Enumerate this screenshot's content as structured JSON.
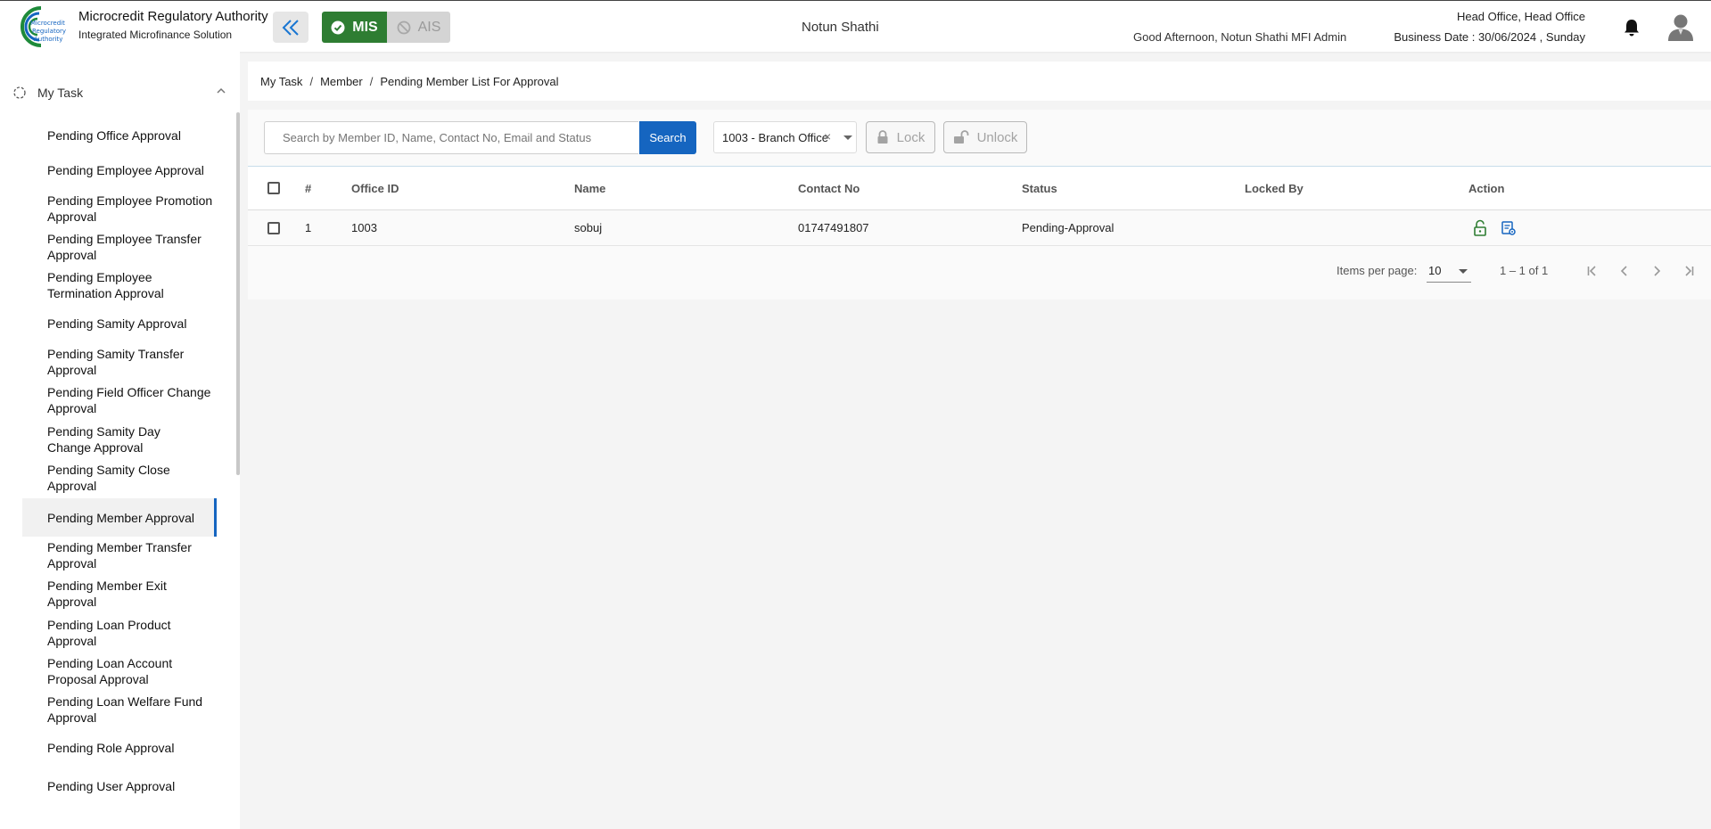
{
  "header": {
    "brand_title": "Microcredit Regulatory Authority",
    "brand_subtitle": "Integrated Microfinance Solution",
    "logo_lines": [
      "Microcredit",
      "Regulatory",
      "Authority"
    ],
    "mis_label": "MIS",
    "ais_label": "AIS",
    "org_name": "Notun Shathi",
    "greeting": "Good Afternoon, Notun Shathi MFI Admin",
    "office": "Head Office, Head Office",
    "business_date": "Business Date : 30/06/2024 , Sunday"
  },
  "sidebar": {
    "section_label": "My Task",
    "items": [
      {
        "label": "Pending Office Approval",
        "active": false
      },
      {
        "label": "Pending Employee Approval",
        "active": false
      },
      {
        "label": "Pending Employee Promotion Approval",
        "active": false
      },
      {
        "label": "Pending Employee Transfer Approval",
        "active": false
      },
      {
        "label": "Pending Employee Termination Approval",
        "active": false
      },
      {
        "label": "Pending Samity Approval",
        "active": false
      },
      {
        "label": "Pending Samity Transfer Approval",
        "active": false
      },
      {
        "label": "Pending Field Officer Change Approval",
        "active": false
      },
      {
        "label": "Pending Samity Day Change Approval",
        "active": false
      },
      {
        "label": "Pending Samity Close Approval",
        "active": false
      },
      {
        "label": "Pending Member Approval",
        "active": true
      },
      {
        "label": "Pending Member Transfer Approval",
        "active": false
      },
      {
        "label": "Pending Member Exit Approval",
        "active": false
      },
      {
        "label": "Pending Loan Product Approval",
        "active": false
      },
      {
        "label": "Pending Loan Account Proposal Approval",
        "active": false
      },
      {
        "label": "Pending Loan Welfare Fund Approval",
        "active": false
      },
      {
        "label": "Pending Role Approval",
        "active": false
      },
      {
        "label": "Pending User Approval",
        "active": false
      }
    ]
  },
  "breadcrumb": [
    "My Task",
    "Member",
    "Pending Member List For Approval"
  ],
  "toolbar": {
    "search_placeholder": "Search by Member ID, Name, Contact No, Email and Status",
    "search_label": "Search",
    "office_selected": "1003 - Branch Office",
    "lock_label": "Lock",
    "unlock_label": "Unlock"
  },
  "table": {
    "columns": [
      "#",
      "Office ID",
      "Name",
      "Contact No",
      "Status",
      "Locked By",
      "Action"
    ],
    "rows": [
      {
        "index": "1",
        "office_id": "1003",
        "name": "sobuj",
        "contact_no": "01747491807",
        "status": "Pending-Approval",
        "locked_by": ""
      }
    ]
  },
  "paginator": {
    "items_per_page_label": "Items per page:",
    "items_per_page": "10",
    "range": "1 – 1 of 1"
  },
  "colors": {
    "primary": "#1565c0",
    "mis_green": "#2e7d32",
    "unlock_icon_green": "#2e7d32"
  }
}
